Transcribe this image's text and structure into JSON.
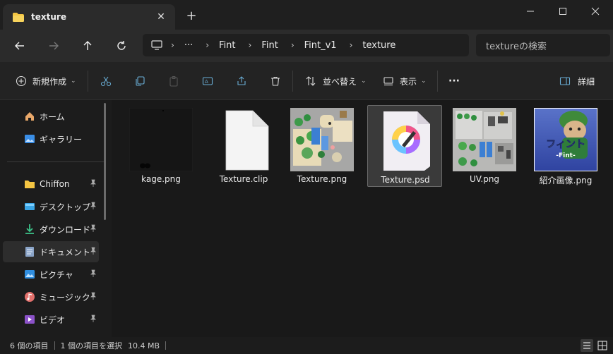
{
  "window": {
    "tab_title": "texture",
    "tab_close": "✕",
    "new_tab": "+"
  },
  "address": {
    "ellipsis": "···",
    "crumbs": [
      "Fint",
      "Fint",
      "Fint_v1",
      "texture"
    ],
    "search_placeholder": "textureの検索"
  },
  "toolbar": {
    "new_label": "新規作成",
    "sort_label": "並べ替え",
    "view_label": "表示",
    "more_label": "···",
    "details_label": "詳細"
  },
  "sidebar": {
    "items": [
      {
        "label": "ホーム",
        "icon": "home-icon"
      },
      {
        "label": "ギャラリー",
        "icon": "gallery-icon"
      },
      {
        "label": "Chiffon",
        "icon": "folder-icon",
        "pinned": true
      },
      {
        "label": "デスクトップ",
        "icon": "desktop-icon",
        "pinned": true
      },
      {
        "label": "ダウンロード",
        "icon": "download-icon",
        "pinned": true
      },
      {
        "label": "ドキュメント",
        "icon": "document-icon",
        "pinned": true
      },
      {
        "label": "ピクチャ",
        "icon": "pictures-icon",
        "pinned": true
      },
      {
        "label": "ミュージック",
        "icon": "music-icon",
        "pinned": true
      },
      {
        "label": "ビデオ",
        "icon": "video-icon",
        "pinned": true
      }
    ]
  },
  "files": [
    {
      "name": "kage.png"
    },
    {
      "name": "Texture.clip"
    },
    {
      "name": "Texture.png"
    },
    {
      "name": "Texture.psd",
      "selected": true
    },
    {
      "name": "UV.png"
    },
    {
      "name": "紹介画像.png",
      "thumb_text": "フィント",
      "thumb_sub": "-Fint-"
    }
  ],
  "status": {
    "item_count": "6 個の項目",
    "selected": "1 個の項目を選択",
    "size": "10.4 MB"
  },
  "colors": {
    "background": "#191919",
    "accent_folder": "#f4c542",
    "selection": "#3a3a3a"
  }
}
